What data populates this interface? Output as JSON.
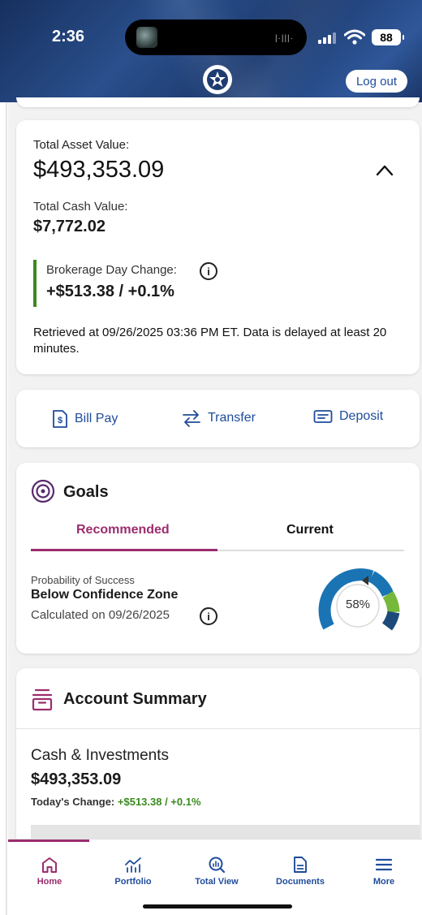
{
  "status": {
    "time": "2:36",
    "battery": "88"
  },
  "header": {
    "logout_label": "Log out"
  },
  "assets": {
    "total_label": "Total Asset Value:",
    "total_value": "$493,353.09",
    "cash_label": "Total Cash Value:",
    "cash_value": "$7,772.02",
    "day_change_label": "Brokerage Day Change:",
    "day_change_value": "+$513.38 / +0.1%",
    "retrieved_text": "Retrieved at 09/26/2025 03:36 PM ET. Data is delayed at least 20 minutes."
  },
  "actions": [
    {
      "label": "Bill Pay",
      "icon": "bill-pay-icon"
    },
    {
      "label": "Transfer",
      "icon": "transfer-icon"
    },
    {
      "label": "Deposit",
      "icon": "deposit-icon"
    }
  ],
  "goals": {
    "title": "Goals",
    "tabs": [
      {
        "label": "Recommended",
        "active": true
      },
      {
        "label": "Current",
        "active": false
      }
    ],
    "prob_label": "Probability of Success",
    "zone": "Below Confidence Zone",
    "calculated": "Calculated on 09/26/2025",
    "gauge_value": "58%",
    "gauge_fraction": 0.58
  },
  "summary": {
    "title": "Account Summary",
    "section_label": "Cash & Investments",
    "section_value": "$493,353.09",
    "change_label": "Today's Change:",
    "change_value": "+$513.38 / +0.1%"
  },
  "nav": [
    {
      "label": "Home",
      "icon": "home-icon",
      "active": true
    },
    {
      "label": "Portfolio",
      "icon": "portfolio-icon",
      "active": false
    },
    {
      "label": "Total View",
      "icon": "total-view-icon",
      "active": false
    },
    {
      "label": "Documents",
      "icon": "documents-icon",
      "active": false
    },
    {
      "label": "More",
      "icon": "menu-icon",
      "active": false
    }
  ],
  "colors": {
    "brand_blue": "#1f4c9c",
    "accent_magenta": "#9b2d6e",
    "positive_green": "#3a8a1e"
  }
}
